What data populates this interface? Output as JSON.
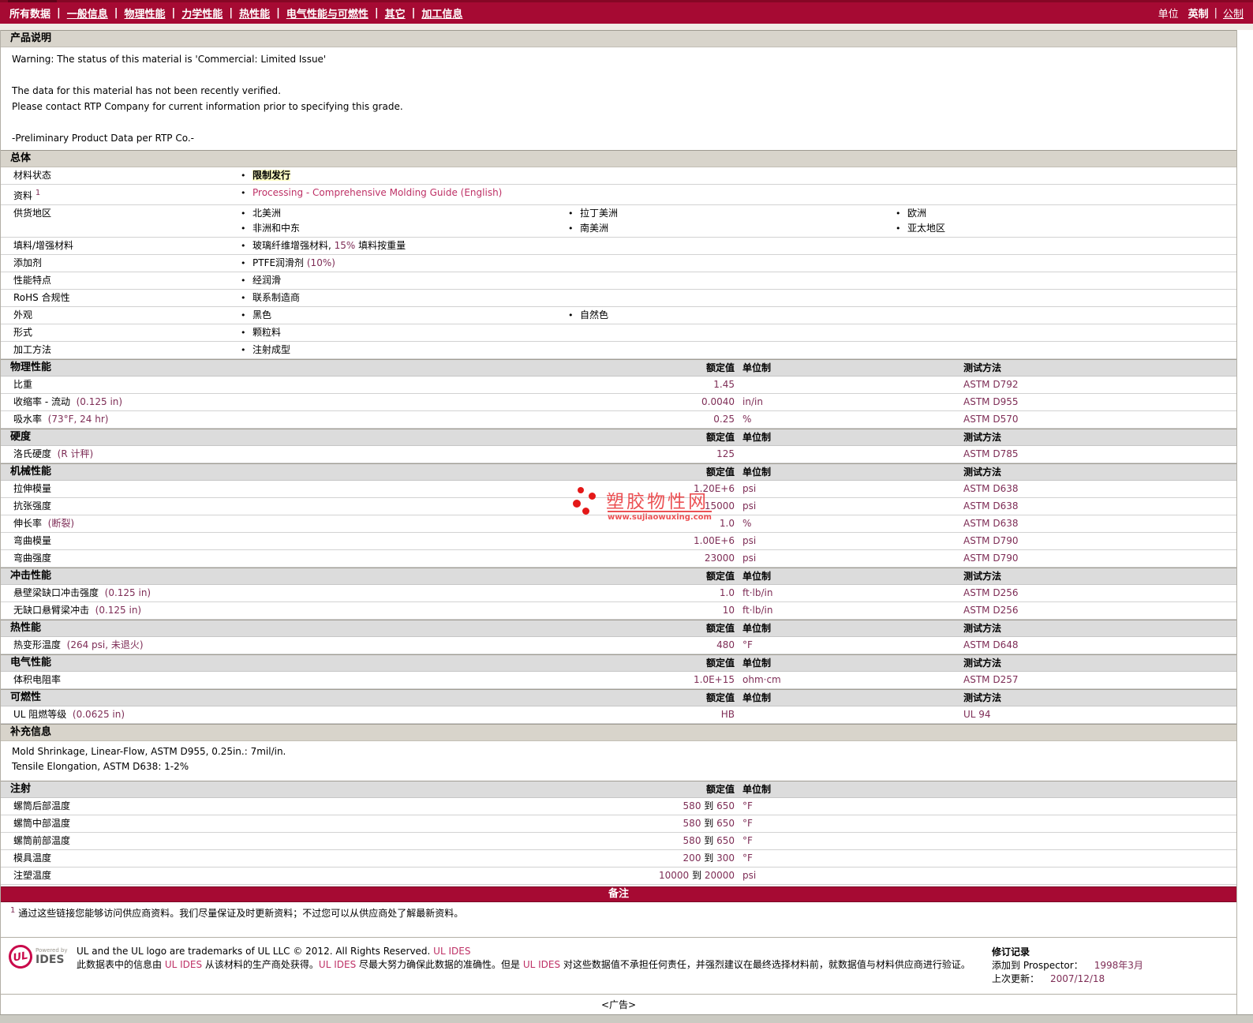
{
  "nav": {
    "items": [
      {
        "key": "all-data",
        "label": "所有数据",
        "active": true
      },
      {
        "key": "general-info",
        "label": "一般信息"
      },
      {
        "key": "physical-properties",
        "label": "物理性能"
      },
      {
        "key": "mechanical-properties",
        "label": "力学性能"
      },
      {
        "key": "thermal-properties",
        "label": "热性能"
      },
      {
        "key": "electrical-flammability",
        "label": "电气性能与可燃性"
      },
      {
        "key": "other",
        "label": "其它"
      },
      {
        "key": "processing-info",
        "label": "加工信息"
      }
    ],
    "units": {
      "label": "单位",
      "english": "英制",
      "sep": "|",
      "metric": "公制"
    }
  },
  "desc": {
    "title": "产品说明",
    "lines": [
      "Warning: The status of this material is 'Commercial: Limited Issue'",
      "",
      "The data for this material has not been recently verified.",
      "Please contact RTP Company for current information prior to specifying this grade.",
      "",
      "-Preliminary Product Data per RTP Co.-"
    ]
  },
  "general": {
    "title": "总体",
    "rows": [
      {
        "label": "材料状态",
        "cols": [
          [
            [
              {
                "t": "限制发行",
                "c": "hl"
              }
            ]
          ]
        ]
      },
      {
        "label": "资料",
        "sup": "1",
        "cols": [
          [
            [
              {
                "t": "Processing - Comprehensive Molding Guide (English)",
                "c": "link"
              }
            ]
          ]
        ]
      },
      {
        "label": "供货地区",
        "cols": [
          [
            "北美洲",
            "非洲和中东"
          ],
          [
            "拉丁美洲",
            "南美洲"
          ],
          [
            "欧洲",
            "亚太地区"
          ]
        ]
      },
      {
        "label": "填料/增强材料",
        "cols": [
          [
            [
              {
                "t": "玻璃纤维增强材料, "
              },
              {
                "t": "15%",
                "c": "val"
              },
              {
                "t": " 填料按重量"
              }
            ]
          ]
        ]
      },
      {
        "label": "添加剂",
        "cols": [
          [
            [
              {
                "t": "PTFE润滑剂 "
              },
              {
                "t": "(10%)",
                "c": "val"
              }
            ]
          ]
        ]
      },
      {
        "label": "性能特点",
        "cols": [
          [
            "经润滑"
          ]
        ]
      },
      {
        "label": "RoHS 合规性",
        "cols": [
          [
            "联系制造商"
          ]
        ]
      },
      {
        "label": "外观",
        "cols": [
          [
            "黑色"
          ],
          [
            "自然色"
          ]
        ]
      },
      {
        "label": "形式",
        "cols": [
          [
            "颗粒料"
          ]
        ]
      },
      {
        "label": "加工方法",
        "cols": [
          [
            "注射成型"
          ]
        ]
      }
    ]
  },
  "prop_header": {
    "value": "额定值",
    "unit": "单位制",
    "method": "测试方法"
  },
  "prop_sections": [
    {
      "title": "物理性能",
      "rows": [
        {
          "name": "比重",
          "value": "1.45",
          "unit": "",
          "method": "ASTM D792"
        },
        {
          "name": "收缩率 - 流动",
          "cond": "(0.125 in)",
          "value": "0.0040",
          "unit": "in/in",
          "method": "ASTM D955"
        },
        {
          "name": "吸水率",
          "cond": "(73°F, 24 hr)",
          "value": "0.25",
          "unit": "%",
          "method": "ASTM D570"
        }
      ]
    },
    {
      "title": "硬度",
      "rows": [
        {
          "name": "洛氏硬度",
          "cond": "(R 计秤)",
          "value": "125",
          "unit": "",
          "method": "ASTM D785"
        }
      ]
    },
    {
      "title": "机械性能",
      "rows": [
        {
          "name": "拉伸模量",
          "value": "1.20E+6",
          "unit": "psi",
          "method": "ASTM D638"
        },
        {
          "name": "抗张强度",
          "value": "15000",
          "unit": "psi",
          "method": "ASTM D638"
        },
        {
          "name": "伸长率",
          "cond": "(断裂)",
          "value": "1.0",
          "unit": "%",
          "method": "ASTM D638"
        },
        {
          "name": "弯曲模量",
          "value": "1.00E+6",
          "unit": "psi",
          "method": "ASTM D790"
        },
        {
          "name": "弯曲强度",
          "value": "23000",
          "unit": "psi",
          "method": "ASTM D790"
        }
      ]
    },
    {
      "title": "冲击性能",
      "rows": [
        {
          "name": "悬壁梁缺口冲击强度",
          "cond": "(0.125 in)",
          "value": "1.0",
          "unit": "ft·lb/in",
          "method": "ASTM D256"
        },
        {
          "name": "无缺口悬臂梁冲击",
          "cond": "(0.125 in)",
          "value": "10",
          "unit": "ft·lb/in",
          "method": "ASTM D256"
        }
      ]
    },
    {
      "title": "热性能",
      "rows": [
        {
          "name": "热变形温度",
          "cond": "(264 psi, 未退火)",
          "value": "480",
          "unit": "°F",
          "method": "ASTM D648"
        }
      ]
    },
    {
      "title": "电气性能",
      "rows": [
        {
          "name": "体积电阻率",
          "value": "1.0E+15",
          "unit": "ohm·cm",
          "method": "ASTM D257"
        }
      ]
    },
    {
      "title": "可燃性",
      "rows": [
        {
          "name": "UL 阻燃等级",
          "cond": "(0.0625 in)",
          "value": "HB",
          "unit": "",
          "method": "UL 94"
        }
      ]
    }
  ],
  "supplemental": {
    "title": "补充信息",
    "lines": [
      "Mold Shrinkage, Linear-Flow, ASTM D955, 0.25in.: 7mil/in.",
      "Tensile Elongation, ASTM D638: 1-2%"
    ]
  },
  "injection": {
    "title": "注射",
    "range_word": "到",
    "rows": [
      {
        "name": "螺筒后部温度",
        "from": "580",
        "to": "650",
        "unit": "°F"
      },
      {
        "name": "螺筒中部温度",
        "from": "580",
        "to": "650",
        "unit": "°F"
      },
      {
        "name": "螺筒前部温度",
        "from": "580",
        "to": "650",
        "unit": "°F"
      },
      {
        "name": "模具温度",
        "from": "200",
        "to": "300",
        "unit": "°F"
      },
      {
        "name": "注塑温度",
        "from": "10000",
        "to": "20000",
        "unit": "psi"
      }
    ]
  },
  "remark": {
    "bar": "备注",
    "sup": "1",
    "text": "通过这些链接您能够访问供应商资料。我们尽量保证及时更新资料；不过您可以从供应商处了解最新资料。"
  },
  "watermark": {
    "title": "塑胶物性网",
    "url": "www.sujiaowuxing.com"
  },
  "footer": {
    "logo": {
      "ul": "UL",
      "powered": "Powered by",
      "ides": "IDES"
    },
    "lines": [
      [
        {
          "t": "UL and the UL logo are trademarks of UL LLC © 2012. All Rights Reserved. "
        },
        {
          "t": "UL IDES",
          "c": "link"
        }
      ],
      [
        {
          "t": "此数据表中的信息由 "
        },
        {
          "t": "UL IDES",
          "c": "link"
        },
        {
          "t": " 从该材料的生产商处获得。"
        },
        {
          "t": "UL IDES",
          "c": "link"
        },
        {
          "t": " 尽最大努力确保此数据的准确性。但是 "
        },
        {
          "t": "UL IDES",
          "c": "link"
        },
        {
          "t": " 对这些数据值不承担任何责任，并强烈建议在最终选择材料前，就数据值与材料供应商进行验证。"
        }
      ]
    ],
    "revision": {
      "title": "修订记录",
      "rows": [
        {
          "label": "添加到 Prospector：",
          "value": "1998年3月"
        },
        {
          "label": "上次更新：",
          "value": "2007/12/18"
        }
      ]
    }
  },
  "ad": {
    "label": "<广告>"
  },
  "colors": {
    "accent_red": "#A60A33",
    "value_maroon": "#7E2D56",
    "link_maroon": "#BE3166",
    "highlight_yellow": "#FFFFC6",
    "watermark_red": "#E8262A",
    "section_header_gray": "#D8D4CB"
  }
}
